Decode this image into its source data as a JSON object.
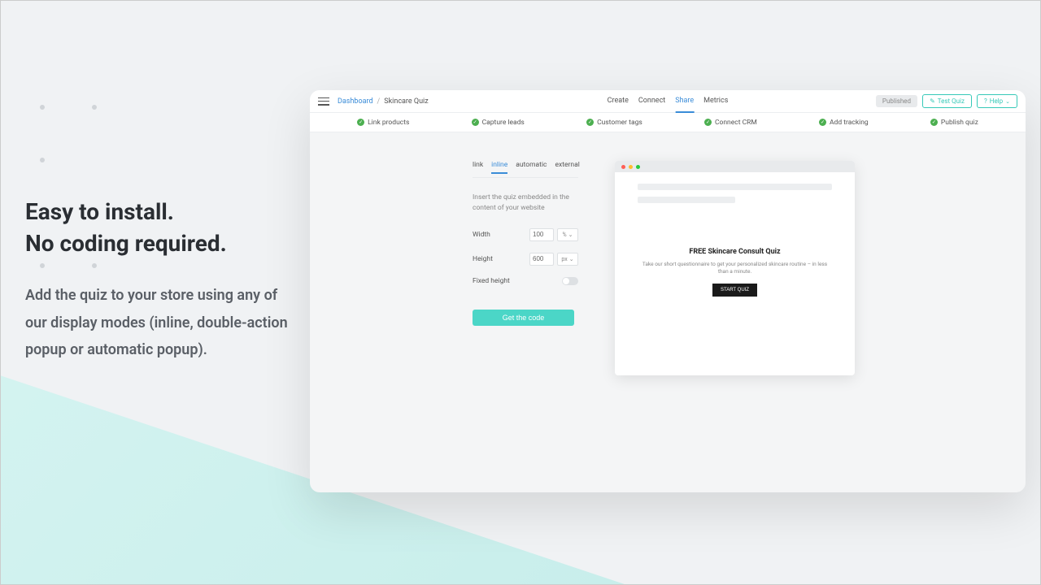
{
  "marketing": {
    "headline_1": "Easy to install.",
    "headline_2": "No coding required.",
    "body": "Add the quiz to your store using any of our display modes (inline, double-action popup or automatic popup)."
  },
  "breadcrumb": {
    "root": "Dashboard",
    "sep": "/",
    "current": "Skincare Quiz"
  },
  "top_tabs": [
    "Create",
    "Connect",
    "Share",
    "Metrics"
  ],
  "top_tab_active": 2,
  "top_right": {
    "published": "Published",
    "test_quiz": "Test Quiz",
    "help": "Help"
  },
  "steps": [
    "Link products",
    "Capture leads",
    "Customer tags",
    "Connect CRM",
    "Add tracking",
    "Publish quiz"
  ],
  "share": {
    "mode_tabs": [
      "link",
      "inline",
      "automatic",
      "external"
    ],
    "mode_active": 1,
    "description": "Insert the quiz embedded in the content of your website",
    "width_label": "Width",
    "width_value": "100",
    "width_unit": "%",
    "height_label": "Height",
    "height_value": "600",
    "height_unit": "px",
    "fixed_height_label": "Fixed height",
    "get_code": "Get the code"
  },
  "preview": {
    "title": "FREE Skincare Consult Quiz",
    "sub": "Take our short questionnaire to get your personalized skincare routine – in less than a minute.",
    "cta": "START QUIZ"
  }
}
